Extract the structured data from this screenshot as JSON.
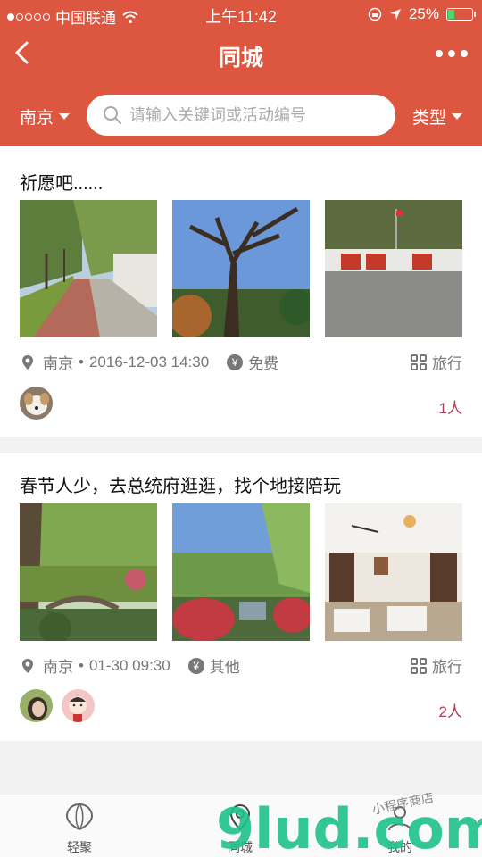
{
  "status": {
    "carrier": "中国联通",
    "time": "上午11:42",
    "battery": "25%",
    "battery_level": 0.25
  },
  "nav": {
    "title": "同城"
  },
  "filter": {
    "city": "南京",
    "search_placeholder": "请输入关键词或活动编号",
    "type": "类型"
  },
  "posts": [
    {
      "title": "祈愿吧......",
      "location": "南京",
      "sep": "•",
      "datetime": "2016-12-03 14:30",
      "fee": "免费",
      "category": "旅行",
      "count": "1人"
    },
    {
      "title": "春节人少，去总统府逛逛，找个地接陪玩",
      "location": "南京",
      "sep": "•",
      "datetime": "01-30 09:30",
      "fee": "其他",
      "category": "旅行",
      "count": "2人"
    }
  ],
  "tabs": {
    "t1": "轻聚",
    "t2": "同城",
    "t3": "我的"
  },
  "watermark": {
    "logo": "9lud.com",
    "tagline": "小程序商店"
  }
}
